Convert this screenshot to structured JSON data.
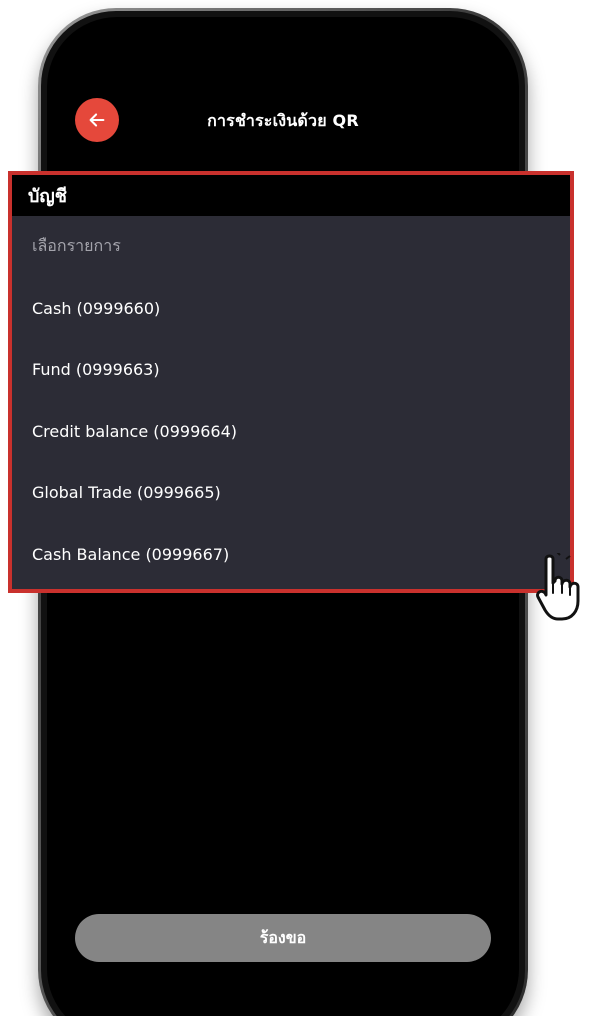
{
  "header": {
    "title": "การชำระเงินด้วย QR",
    "back_icon": "arrow-left-icon",
    "accent_color": "#e5483b"
  },
  "dropdown": {
    "label": "บัญชี",
    "placeholder": "เลือกรายการ",
    "items": [
      "Cash (0999660)",
      "Fund (0999663)",
      "Credit balance (0999664)",
      "Global Trade (0999665)",
      "Cash Balance (0999667)"
    ],
    "highlight_color": "#c9312d"
  },
  "footer": {
    "request_label": "ร้องขอ"
  },
  "cursor": {
    "icon": "pointing-hand-icon"
  }
}
